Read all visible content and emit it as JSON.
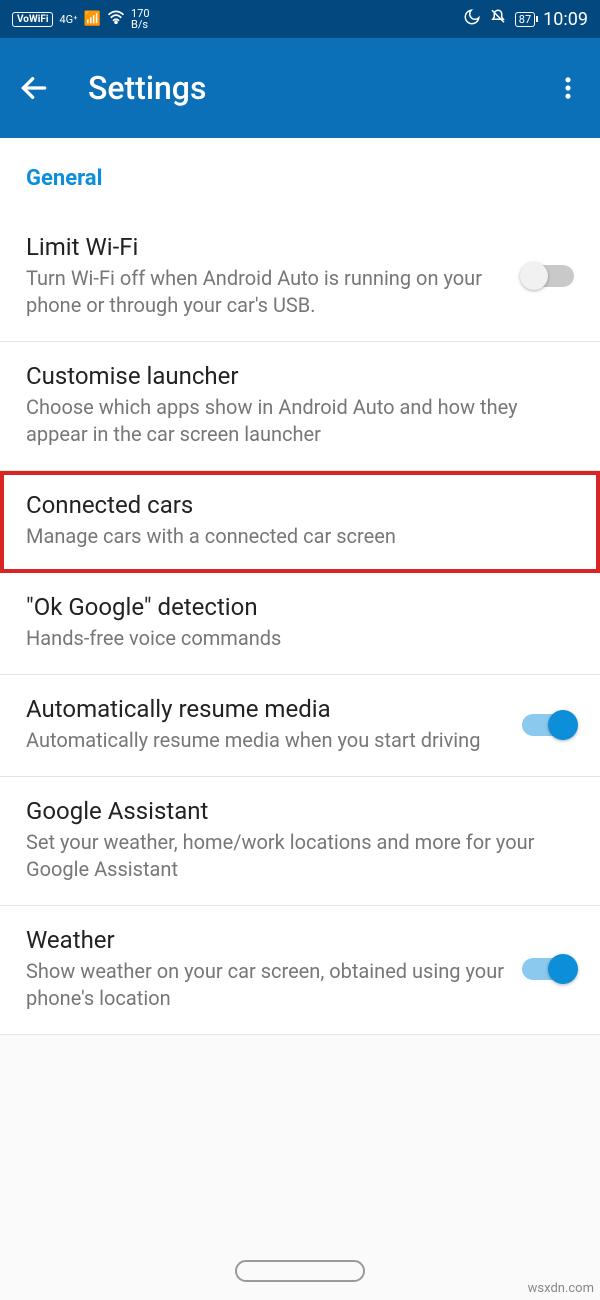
{
  "status": {
    "vowifi": "VoWiFi",
    "signal": "4G⁺",
    "speed_top": "170",
    "speed_bot": "B/s",
    "battery": "87",
    "time": "10:09"
  },
  "appbar": {
    "title": "Settings"
  },
  "section": {
    "general": "General"
  },
  "items": [
    {
      "title": "Limit Wi-Fi",
      "sub": "Turn Wi-Fi off when Android Auto is running on your phone or through your car's USB.",
      "toggle": "off"
    },
    {
      "title": "Customise launcher",
      "sub": "Choose which apps show in Android Auto and how they appear in the car screen launcher"
    },
    {
      "title": "Connected cars",
      "sub": "Manage cars with a connected car screen",
      "highlight": true
    },
    {
      "title": "\"Ok Google\" detection",
      "sub": "Hands-free voice commands"
    },
    {
      "title": "Automatically resume media",
      "sub": "Automatically resume media when you start driving",
      "toggle": "on"
    },
    {
      "title": "Google Assistant",
      "sub": "Set your weather, home/work locations and more for your Google Assistant"
    },
    {
      "title": "Weather",
      "sub": "Show weather on your car screen, obtained using your phone's location",
      "toggle": "on"
    }
  ],
  "watermark": "wsxdn.com"
}
